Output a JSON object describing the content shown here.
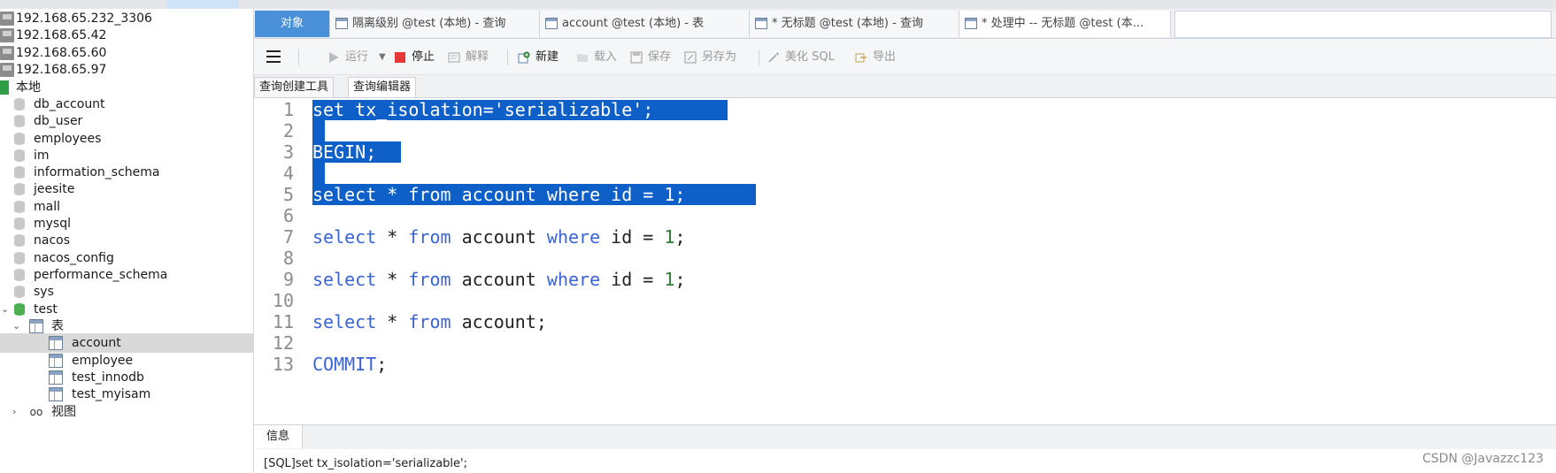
{
  "sidebar": {
    "connections": [
      "192.168.65.232_3306",
      "192.168.65.42",
      "192.168.65.60",
      "192.168.65.97"
    ],
    "local_label": "本地",
    "databases": [
      "db_account",
      "db_user",
      "employees",
      "im",
      "information_schema",
      "jeesite",
      "mall",
      "mysql",
      "nacos",
      "nacos_config",
      "performance_schema",
      "sys"
    ],
    "open_db": "test",
    "tables_group": "表",
    "tables": [
      "account",
      "employee",
      "test_innodb",
      "test_myisam"
    ],
    "selected_table": "account",
    "views_group": "视图"
  },
  "tabs": [
    {
      "label": "对象",
      "kind": "objects"
    },
    {
      "label": "隔离级别 @test (本地) - 查询",
      "kind": "query"
    },
    {
      "label": "account @test (本地) - 表",
      "kind": "table"
    },
    {
      "label": "* 无标题 @test (本地) - 查询",
      "kind": "query"
    },
    {
      "label": "* 处理中 -- 无标题 @test (本...",
      "kind": "query",
      "active": true
    }
  ],
  "toolbar": {
    "run": "运行",
    "stop": "停止",
    "explain": "解释",
    "new": "新建",
    "load": "载入",
    "save": "保存",
    "save_as": "另存为",
    "beautify": "美化 SQL",
    "export": "导出"
  },
  "subtabs": [
    "查询创建工具",
    "查询编辑器"
  ],
  "active_subtab": "查询编辑器",
  "editor": {
    "line_numbers": [
      "1",
      "2",
      "3",
      "4",
      "5",
      "6",
      "7",
      "8",
      "9",
      "10",
      "11",
      "12",
      "13"
    ],
    "lines": [
      "set tx_isolation='serializable';",
      "",
      "BEGIN;",
      "",
      "select * from account where id = 1;",
      "",
      "select * from account where id = 1;",
      "",
      "select * from account where id = 1;",
      "",
      "select * from account;",
      "",
      "COMMIT;"
    ],
    "selected_lines": [
      1,
      2,
      3,
      4,
      5
    ]
  },
  "info": {
    "tab": "信息",
    "message": "[SQL]set tx_isolation='serializable';"
  },
  "watermark": "CSDN @Javazzc123",
  "colors": {
    "selection": "#0f5fc9",
    "keyword": "#3a63d8",
    "number": "#2e7d32",
    "objects_tab": "#4a90d9"
  }
}
